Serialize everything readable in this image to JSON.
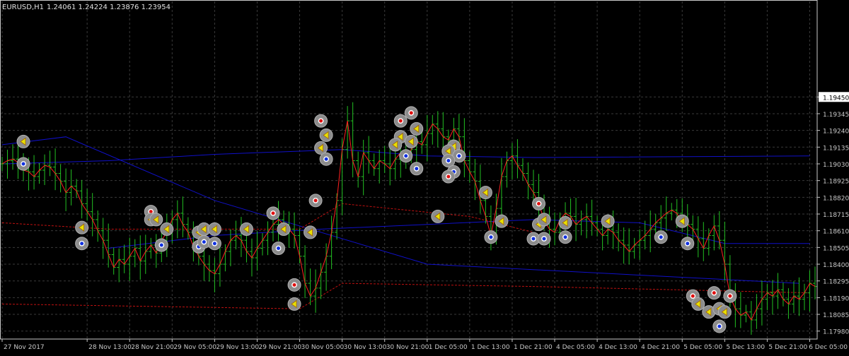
{
  "header": {
    "symbol": "EURUSD,H1",
    "ohlc": "1.24061 1.24224 1.23876 1.23954"
  },
  "colors": {
    "background": "#000000",
    "grid": "#3a3a3a",
    "axis": "#c8c8c8",
    "bar": "#22c022",
    "close_line": "#ff2020",
    "blue_ma": "#1010c8",
    "red_ma": "#c01010",
    "marker_fill": "#8c8c8c"
  },
  "chart_data": {
    "type": "line",
    "ylim": [
      1.1793,
      1.2005
    ],
    "y_ticks": [
      "1.19450",
      "1.19345",
      "1.19240",
      "1.19135",
      "1.19030",
      "1.18925",
      "1.18820",
      "1.18715",
      "1.18610",
      "1.18505",
      "1.18400",
      "1.18295",
      "1.18190",
      "1.18085",
      "1.17980"
    ],
    "y_tick_values": [
      1.1945,
      1.19345,
      1.1924,
      1.19135,
      1.1903,
      1.18925,
      1.1882,
      1.18715,
      1.1861,
      1.18505,
      1.184,
      1.18295,
      1.1819,
      1.18085,
      1.1798
    ],
    "current_price_label": "1.19450",
    "x_ticks": [
      "27 Nov 2017",
      "28 Nov 13:00",
      "28 Nov 21:00",
      "29 Nov 05:00",
      "29 Nov 13:00",
      "29 Nov 21:00",
      "30 Nov 05:00",
      "30 Nov 13:00",
      "30 Nov 21:00",
      "1 Dec 05:00",
      "1 Dec 13:00",
      "1 Dec 21:00",
      "4 Dec 05:00",
      "4 Dec 13:00",
      "4 Dec 21:00",
      "5 Dec 05:00",
      "5 Dec 13:00",
      "5 Dec 21:00",
      "6 Dec 05:00"
    ],
    "x_tick_index": [
      0,
      16,
      24,
      32,
      40,
      48,
      56,
      64,
      72,
      80,
      88,
      96,
      104,
      112,
      120,
      128,
      136,
      144,
      152
    ],
    "close_series": [
      1.1903,
      1.1905,
      1.1906,
      1.1904,
      1.1899,
      1.1898,
      1.1895,
      1.1899,
      1.1902,
      1.1901,
      1.1897,
      1.1892,
      1.1885,
      1.1889,
      1.1886,
      1.1878,
      1.1873,
      1.1868,
      1.1861,
      1.1855,
      1.1846,
      1.1838,
      1.1843,
      1.184,
      1.1845,
      1.185,
      1.1842,
      1.1848,
      1.1852,
      1.1847,
      1.1855,
      1.186,
      1.1868,
      1.1872,
      1.1865,
      1.186,
      1.1851,
      1.1845,
      1.184,
      1.1836,
      1.1834,
      1.184,
      1.1848,
      1.1855,
      1.1858,
      1.1855,
      1.1848,
      1.1844,
      1.185,
      1.1855,
      1.186,
      1.1865,
      1.1868,
      1.1865,
      1.1862,
      1.1858,
      1.1845,
      1.1828,
      1.182,
      1.1825,
      1.1835,
      1.1845,
      1.186,
      1.188,
      1.1912,
      1.193,
      1.1905,
      1.1895,
      1.191,
      1.1905,
      1.19,
      1.1905,
      1.1903,
      1.19,
      1.1906,
      1.191,
      1.1908,
      1.1912,
      1.1917,
      1.1915,
      1.1922,
      1.1928,
      1.1925,
      1.192,
      1.1918,
      1.1925,
      1.192,
      1.1905,
      1.1898,
      1.1892,
      1.188,
      1.187,
      1.1858,
      1.1875,
      1.1895,
      1.1905,
      1.1908,
      1.1902,
      1.1897,
      1.189,
      1.1885,
      1.1878,
      1.1868,
      1.1862,
      1.186,
      1.1868,
      1.1872,
      1.187,
      1.1865,
      1.1868,
      1.187,
      1.1866,
      1.1862,
      1.1858,
      1.1862,
      1.186,
      1.1855,
      1.1852,
      1.1848,
      1.1852,
      1.1855,
      1.1858,
      1.1862,
      1.1866,
      1.1869,
      1.1872,
      1.1874,
      1.1872,
      1.1866,
      1.1865,
      1.1862,
      1.1856,
      1.185,
      1.1858,
      1.1864,
      1.1855,
      1.184,
      1.182,
      1.1812,
      1.1808,
      1.181,
      1.1805,
      1.1812,
      1.1818,
      1.1822,
      1.182,
      1.1824,
      1.1818,
      1.1815,
      1.182,
      1.1818,
      1.1822,
      1.1828,
      1.1826
    ],
    "moving_averages": [
      {
        "color": "blue",
        "values": [
          [
            0,
            1.1915
          ],
          [
            12,
            1.192
          ],
          [
            40,
            1.188
          ],
          [
            80,
            1.184
          ],
          [
            150,
            1.1828
          ]
        ]
      },
      {
        "color": "blue",
        "values": [
          [
            0,
            1.1903
          ],
          [
            20,
            1.1905
          ],
          [
            40,
            1.1909
          ],
          [
            64,
            1.1912
          ],
          [
            80,
            1.1908
          ],
          [
            100,
            1.1907
          ],
          [
            152,
            1.1908
          ]
        ]
      },
      {
        "color": "blue",
        "values": [
          [
            20,
            1.185
          ],
          [
            40,
            1.1858
          ],
          [
            60,
            1.1862
          ],
          [
            80,
            1.1865
          ],
          [
            100,
            1.1868
          ],
          [
            120,
            1.1866
          ],
          [
            136,
            1.1853
          ],
          [
            152,
            1.1853
          ]
        ]
      },
      {
        "color": "red",
        "values": [
          [
            0,
            1.1866
          ],
          [
            20,
            1.1862
          ],
          [
            56,
            1.1862
          ],
          [
            64,
            1.1878
          ],
          [
            88,
            1.187
          ],
          [
            100,
            1.186
          ]
        ]
      },
      {
        "color": "red",
        "values": [
          [
            0,
            1.1815
          ],
          [
            56,
            1.1812
          ],
          [
            64,
            1.1828
          ],
          [
            100,
            1.1826
          ],
          [
            152,
            1.1822
          ]
        ]
      }
    ],
    "markers": [
      {
        "i": 4,
        "p": 1.1917,
        "k": "arrow"
      },
      {
        "i": 4,
        "p": 1.1903,
        "k": "blue"
      },
      {
        "i": 15,
        "p": 1.1863,
        "k": "arrow"
      },
      {
        "i": 15,
        "p": 1.1853,
        "k": "blue"
      },
      {
        "i": 28,
        "p": 1.1873,
        "k": "red"
      },
      {
        "i": 28,
        "p": 1.1868,
        "k": "arrow"
      },
      {
        "i": 29,
        "p": 1.1868,
        "k": "arrow"
      },
      {
        "i": 31,
        "p": 1.1862,
        "k": "arrow"
      },
      {
        "i": 30,
        "p": 1.1852,
        "k": "blue"
      },
      {
        "i": 37,
        "p": 1.186,
        "k": "arrow"
      },
      {
        "i": 38,
        "p": 1.1862,
        "k": "arrow"
      },
      {
        "i": 37,
        "p": 1.1851,
        "k": "blue"
      },
      {
        "i": 38,
        "p": 1.1854,
        "k": "blue"
      },
      {
        "i": 40,
        "p": 1.1862,
        "k": "arrow"
      },
      {
        "i": 40,
        "p": 1.1853,
        "k": "blue"
      },
      {
        "i": 46,
        "p": 1.1862,
        "k": "arrow"
      },
      {
        "i": 51,
        "p": 1.1872,
        "k": "red"
      },
      {
        "i": 53,
        "p": 1.1862,
        "k": "arrow"
      },
      {
        "i": 52,
        "p": 1.185,
        "k": "blue"
      },
      {
        "i": 55,
        "p": 1.1827,
        "k": "red"
      },
      {
        "i": 55,
        "p": 1.1815,
        "k": "arrow"
      },
      {
        "i": 58,
        "p": 1.186,
        "k": "arrow"
      },
      {
        "i": 59,
        "p": 1.188,
        "k": "red"
      },
      {
        "i": 60,
        "p": 1.193,
        "k": "red"
      },
      {
        "i": 61,
        "p": 1.1921,
        "k": "arrow"
      },
      {
        "i": 60,
        "p": 1.1913,
        "k": "arrow"
      },
      {
        "i": 61,
        "p": 1.1906,
        "k": "blue"
      },
      {
        "i": 75,
        "p": 1.193,
        "k": "red"
      },
      {
        "i": 77,
        "p": 1.1935,
        "k": "red"
      },
      {
        "i": 78,
        "p": 1.1925,
        "k": "arrow"
      },
      {
        "i": 75,
        "p": 1.192,
        "k": "arrow"
      },
      {
        "i": 74,
        "p": 1.1915,
        "k": "arrow"
      },
      {
        "i": 77,
        "p": 1.1917,
        "k": "arrow"
      },
      {
        "i": 76,
        "p": 1.1908,
        "k": "blue"
      },
      {
        "i": 78,
        "p": 1.19,
        "k": "blue"
      },
      {
        "i": 85,
        "p": 1.1914,
        "k": "arrow"
      },
      {
        "i": 84,
        "p": 1.1911,
        "k": "arrow"
      },
      {
        "i": 86,
        "p": 1.1908,
        "k": "blue"
      },
      {
        "i": 84,
        "p": 1.1905,
        "k": "blue"
      },
      {
        "i": 85,
        "p": 1.1898,
        "k": "blue"
      },
      {
        "i": 84,
        "p": 1.1895,
        "k": "red"
      },
      {
        "i": 82,
        "p": 1.187,
        "k": "arrow"
      },
      {
        "i": 91,
        "p": 1.1885,
        "k": "arrow"
      },
      {
        "i": 92,
        "p": 1.1857,
        "k": "blue"
      },
      {
        "i": 94,
        "p": 1.1867,
        "k": "arrow"
      },
      {
        "i": 101,
        "p": 1.1878,
        "k": "red"
      },
      {
        "i": 101,
        "p": 1.1865,
        "k": "arrow"
      },
      {
        "i": 102,
        "p": 1.1868,
        "k": "arrow"
      },
      {
        "i": 100,
        "p": 1.1856,
        "k": "blue"
      },
      {
        "i": 102,
        "p": 1.1856,
        "k": "blue"
      },
      {
        "i": 106,
        "p": 1.1866,
        "k": "arrow"
      },
      {
        "i": 106,
        "p": 1.1857,
        "k": "blue"
      },
      {
        "i": 114,
        "p": 1.1867,
        "k": "arrow"
      },
      {
        "i": 124,
        "p": 1.1857,
        "k": "blue"
      },
      {
        "i": 128,
        "p": 1.1867,
        "k": "arrow"
      },
      {
        "i": 129,
        "p": 1.1853,
        "k": "blue"
      },
      {
        "i": 130,
        "p": 1.182,
        "k": "red"
      },
      {
        "i": 131,
        "p": 1.1815,
        "k": "arrow"
      },
      {
        "i": 133,
        "p": 1.181,
        "k": "arrow"
      },
      {
        "i": 134,
        "p": 1.1822,
        "k": "red"
      },
      {
        "i": 135,
        "p": 1.1812,
        "k": "arrow"
      },
      {
        "i": 136,
        "p": 1.181,
        "k": "arrow"
      },
      {
        "i": 137,
        "p": 1.182,
        "k": "red"
      },
      {
        "i": 135,
        "p": 1.1801,
        "k": "blue"
      }
    ]
  }
}
